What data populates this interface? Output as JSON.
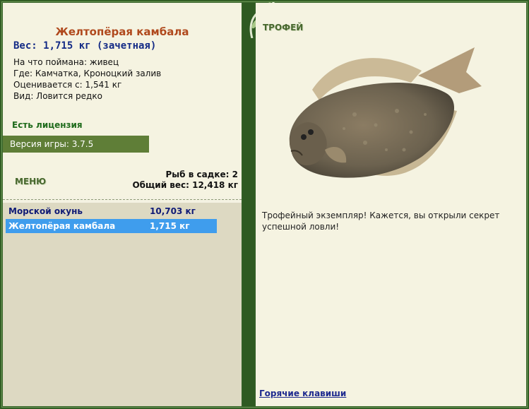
{
  "fish": {
    "title": "Желтопёрая камбала",
    "weight_line": "Вес: 1,715 кг (зачетная)",
    "info": [
      "На что поймана: живец",
      "Где: Камчатка, Кроноцкий залив",
      "Оценивается с: 1,541 кг",
      "Вид: Ловится редко"
    ]
  },
  "license": "Есть лицензия",
  "version": "Версия игры: 3.7.5",
  "menu_label": "МЕНЮ",
  "cage": {
    "count_line": "Рыб в садке: 2",
    "total_line": "Общий вес: 12,418 кг"
  },
  "catch_list": [
    {
      "name": "Морской окунь",
      "weight": "10,703 кг",
      "selected": false
    },
    {
      "name": "Желтопёрая камбала",
      "weight": "1,715 кг",
      "selected": true
    }
  ],
  "trophy": {
    "label": "ТРОФЕЙ",
    "text": "Трофейный экземпляр! Кажется, вы открыли секрет успешной ловли!"
  },
  "hotkeys": "Горячие клавиши",
  "colors": {
    "frame": "#325e25",
    "panel": "#f5f3e1",
    "list_bg": "#ddd9c2",
    "title": "#b0491d",
    "weight": "#142b86",
    "selected_row": "#3f9ded",
    "version_bar": "#5f7e37"
  },
  "icons": [
    "vine-ornament-icon",
    "flounder-fish-image"
  ]
}
